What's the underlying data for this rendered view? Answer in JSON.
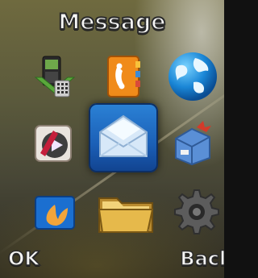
{
  "menu": {
    "title": "Message",
    "selected_item": "message-icon",
    "items": [
      {
        "icon": "phone-tools-icon"
      },
      {
        "icon": "contacts-icon"
      },
      {
        "icon": "internet-globe-icon"
      },
      {
        "icon": "media-player-icon"
      },
      {
        "icon": "message-icon"
      },
      {
        "icon": "app-box-icon"
      },
      {
        "icon": "fun-app-icon"
      },
      {
        "icon": "file-manager-icon"
      },
      {
        "icon": "settings-gear-icon"
      }
    ]
  },
  "softkeys": {
    "left": "OK",
    "right": "Back"
  },
  "colors": {
    "selection": "#1b5fb6",
    "background": "#5b5a3c",
    "text": "#f6f6f6"
  }
}
